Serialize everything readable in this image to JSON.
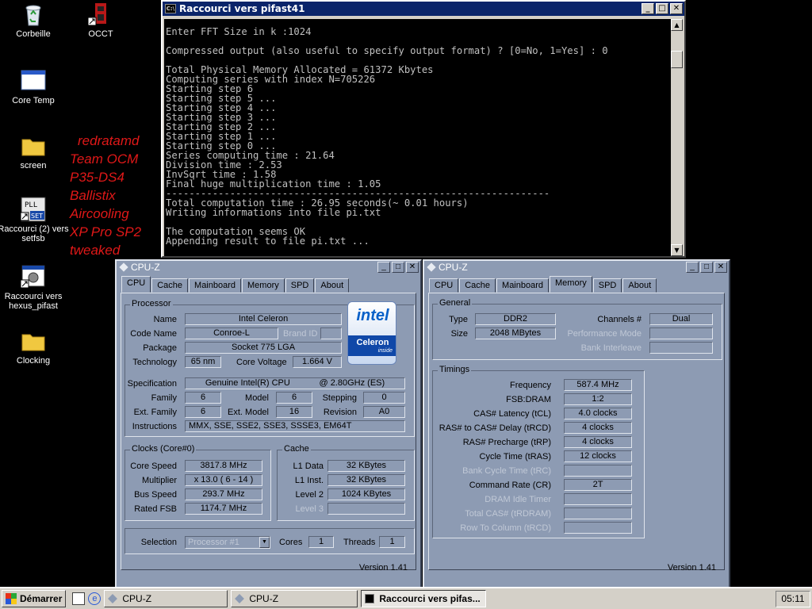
{
  "desktop": {
    "icons": [
      {
        "label": "Corbeille"
      },
      {
        "label": "OCCT"
      },
      {
        "label": "Core Temp"
      },
      {
        "label": "screen"
      },
      {
        "label": "Raccourci (2) vers setfsb"
      },
      {
        "label": "Raccourci vers hexus_pifast"
      },
      {
        "label": "Clocking"
      }
    ],
    "red_text": [
      "redratamd",
      "Team OCM",
      "P35-DS4",
      "Ballistix",
      "Aircooling",
      "XP Pro SP2",
      "tweaked"
    ]
  },
  "console": {
    "title": "Raccourci vers pifast41",
    "icon_label": "C:\\",
    "lines": [
      "Enter FFT Size in k :1024",
      "",
      "Compressed output (also useful to specify output format) ? [0=No, 1=Yes] : 0",
      "",
      "Total Physical Memory Allocated = 61372 Kbytes",
      "Computing series with index N=705226",
      "Starting step 6",
      "Starting step 5 ...",
      "Starting step 4 ...",
      "Starting step 3 ...",
      "Starting step 2 ...",
      "Starting step 1 ...",
      "Starting step 0 ...",
      "Series computing time : 21.64",
      "Division time : 2.53",
      "InvSqrt time : 1.58",
      "Final huge multiplication time : 1.05",
      "------------------------------------------------------------------",
      "Total computation time : 26.95 seconds(~ 0.01 hours)",
      "Writing informations into file pi.txt",
      "",
      "The computation seems OK",
      "Appending result to file pi.txt ..."
    ]
  },
  "cpuz1": {
    "title": "CPU-Z",
    "tabs": [
      "CPU",
      "Cache",
      "Mainboard",
      "Memory",
      "SPD",
      "About"
    ],
    "processor": {
      "group": "Processor",
      "name_label": "Name",
      "name": "Intel Celeron",
      "codename_label": "Code Name",
      "codename": "Conroe-L",
      "brandid_label": "Brand ID",
      "package_label": "Package",
      "package": "Socket 775 LGA",
      "technology_label": "Technology",
      "technology": "65 nm",
      "corevoltage_label": "Core Voltage",
      "corevoltage": "1.664 V",
      "spec_label": "Specification",
      "spec": "Genuine Intel(R) CPU            @ 2.80GHz (ES)",
      "family_label": "Family",
      "family": "6",
      "model_label": "Model",
      "model": "6",
      "stepping_label": "Stepping",
      "stepping": "0",
      "extfamily_label": "Ext. Family",
      "extfamily": "6",
      "extmodel_label": "Ext. Model",
      "extmodel": "16",
      "revision_label": "Revision",
      "revision": "A0",
      "instructions_label": "Instructions",
      "instructions": "MMX, SSE, SSE2, SSE3, SSSE3, EM64T"
    },
    "logo": {
      "intel": "intel",
      "celeron": "Celeron",
      "inside": "inside"
    },
    "clocks": {
      "group": "Clocks (Core#0)",
      "corespeed_label": "Core Speed",
      "corespeed": "3817.8 MHz",
      "multiplier_label": "Multiplier",
      "multiplier": "x 13.0 ( 6 - 14 )",
      "busspeed_label": "Bus Speed",
      "busspeed": "293.7 MHz",
      "ratedfsb_label": "Rated FSB",
      "ratedfsb": "1174.7 MHz"
    },
    "cache": {
      "group": "Cache",
      "l1data_label": "L1 Data",
      "l1data": "32 KBytes",
      "l1inst_label": "L1 Inst.",
      "l1inst": "32 KBytes",
      "level2_label": "Level 2",
      "level2": "1024 KBytes",
      "level3_label": "Level 3"
    },
    "selection_label": "Selection",
    "selection": "Processor #1",
    "cores_label": "Cores",
    "cores": "1",
    "threads_label": "Threads",
    "threads": "1",
    "version": "Version 1.41"
  },
  "cpuz2": {
    "title": "CPU-Z",
    "tabs": [
      "CPU",
      "Cache",
      "Mainboard",
      "Memory",
      "SPD",
      "About"
    ],
    "general": {
      "group": "General",
      "type_label": "Type",
      "type": "DDR2",
      "size_label": "Size",
      "size": "2048 MBytes",
      "channels_label": "Channels #",
      "channels": "Dual",
      "perfmode_label": "Performance Mode",
      "bankinterleave_label": "Bank Interleave"
    },
    "timings": {
      "group": "Timings",
      "rows": [
        {
          "label": "Frequency",
          "value": "587.4 MHz",
          "dim": false
        },
        {
          "label": "FSB:DRAM",
          "value": "1:2",
          "dim": false
        },
        {
          "label": "CAS# Latency (tCL)",
          "value": "4.0 clocks",
          "dim": false
        },
        {
          "label": "RAS# to CAS# Delay (tRCD)",
          "value": "4 clocks",
          "dim": false
        },
        {
          "label": "RAS# Precharge (tRP)",
          "value": "4 clocks",
          "dim": false
        },
        {
          "label": "Cycle Time (tRAS)",
          "value": "12 clocks",
          "dim": false
        },
        {
          "label": "Bank Cycle Time (tRC)",
          "value": "",
          "dim": true
        },
        {
          "label": "Command Rate (CR)",
          "value": "2T",
          "dim": false
        },
        {
          "label": "DRAM Idle Timer",
          "value": "",
          "dim": true
        },
        {
          "label": "Total CAS# (tRDRAM)",
          "value": "",
          "dim": true
        },
        {
          "label": "Row To Column (tRCD)",
          "value": "",
          "dim": true
        }
      ]
    },
    "version": "Version 1.41"
  },
  "taskbar": {
    "start": "Démarrer",
    "tasks": [
      "CPU-Z",
      "CPU-Z",
      "Raccourci vers pifas..."
    ],
    "clock": "05:11"
  },
  "colors": {
    "cpuz_bg": "#8d9bb3",
    "title_active": "#0a246a",
    "red_text": "#e01818"
  }
}
